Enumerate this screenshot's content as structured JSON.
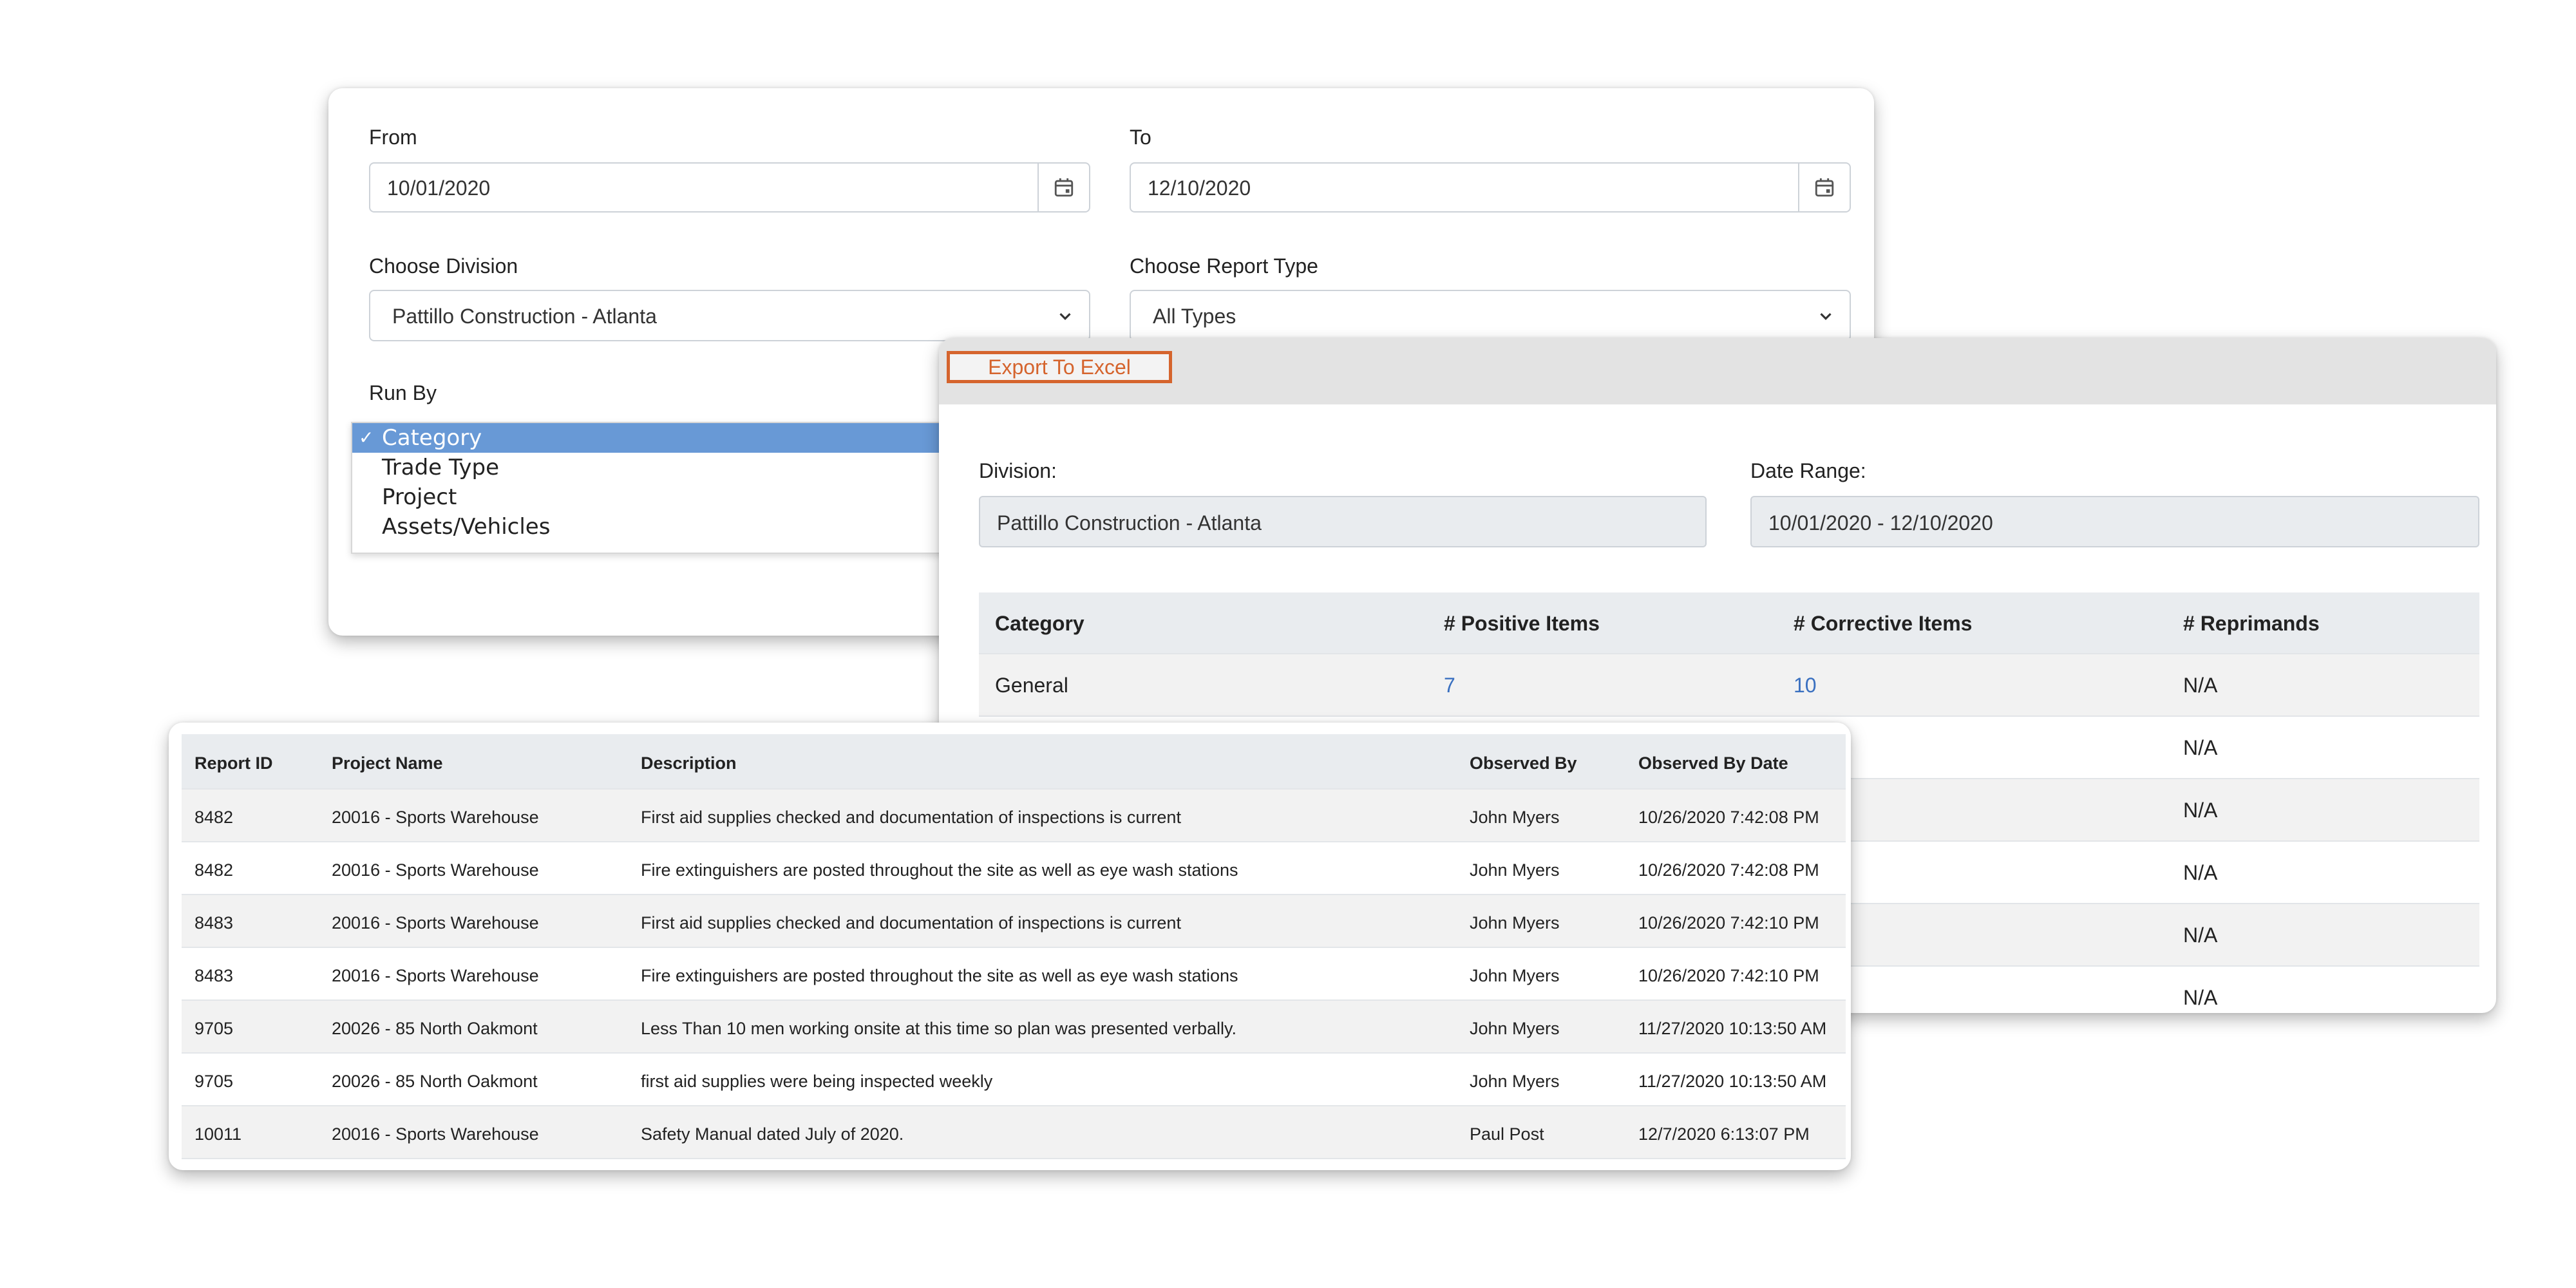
{
  "filter": {
    "from_label": "From",
    "from_value": "10/01/2020",
    "to_label": "To",
    "to_value": "12/10/2020",
    "division_label": "Choose Division",
    "division_value": "Pattillo Construction - Atlanta",
    "report_type_label": "Choose Report Type",
    "report_type_value": "All Types",
    "run_by_label": "Run By",
    "run_by_options": [
      {
        "label": "Category",
        "selected": true
      },
      {
        "label": "Trade Type",
        "selected": false
      },
      {
        "label": "Project",
        "selected": false
      },
      {
        "label": "Assets/Vehicles",
        "selected": false
      }
    ]
  },
  "summary": {
    "export_label": "Export To Excel",
    "division_label": "Division:",
    "division_value": "Pattillo Construction - Atlanta",
    "date_range_label": "Date Range:",
    "date_range_value": "10/01/2020 - 12/10/2020",
    "columns": [
      "Category",
      "# Positive Items",
      "# Corrective Items",
      "# Reprimands"
    ],
    "rows": [
      [
        "General",
        "7",
        "10",
        "N/A"
      ],
      [
        "",
        "",
        "",
        "N/A"
      ],
      [
        "",
        "",
        "",
        "N/A"
      ],
      [
        "",
        "",
        "",
        "N/A"
      ],
      [
        "",
        "",
        "",
        "N/A"
      ],
      [
        "",
        "",
        "",
        "N/A"
      ]
    ]
  },
  "detail": {
    "columns": [
      "Report ID",
      "Project Name",
      "Description",
      "Observed By",
      "Observed By Date"
    ],
    "rows": [
      [
        "8482",
        "20016 - Sports Warehouse",
        "First aid supplies checked and documentation of inspections is current",
        "John Myers",
        "10/26/2020 7:42:08 PM"
      ],
      [
        "8482",
        "20016 - Sports Warehouse",
        "Fire extinguishers are posted throughout the site as well as eye wash stations",
        "John Myers",
        "10/26/2020 7:42:08 PM"
      ],
      [
        "8483",
        "20016 - Sports Warehouse",
        "First aid supplies checked and documentation of inspections is current",
        "John Myers",
        "10/26/2020 7:42:10 PM"
      ],
      [
        "8483",
        "20016 - Sports Warehouse",
        "Fire extinguishers are posted throughout the site as well as eye wash stations",
        "John Myers",
        "10/26/2020 7:42:10 PM"
      ],
      [
        "9705",
        "20026 - 85 North Oakmont",
        "Less Than 10 men working onsite at this time so plan was presented verbally.",
        "John Myers",
        "11/27/2020 10:13:50 AM"
      ],
      [
        "9705",
        "20026 - 85 North Oakmont",
        "first aid supplies were being inspected weekly",
        "John Myers",
        "11/27/2020 10:13:50 AM"
      ],
      [
        "10011",
        "20016 - Sports Warehouse",
        "Safety Manual dated July of 2020.",
        "Paul Post",
        "12/7/2020 6:13:07 PM"
      ]
    ]
  },
  "colors": {
    "accent_orange": "#d5642d",
    "link_blue": "#3a70c0",
    "selected_option": "#6899d6"
  },
  "icons": [
    "calendar-icon",
    "chevron-down-icon",
    "check-icon"
  ]
}
